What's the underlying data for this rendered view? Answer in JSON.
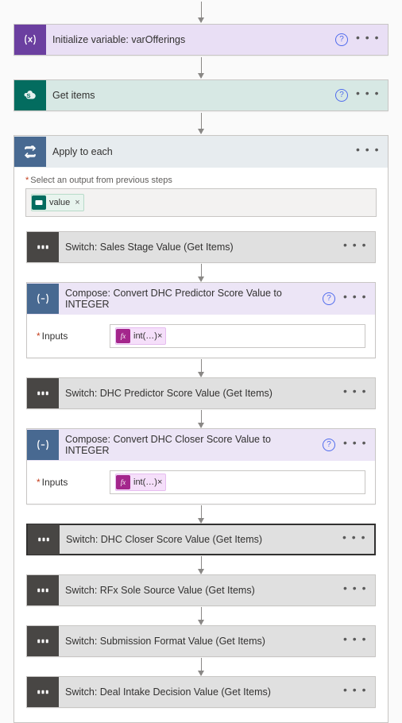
{
  "steps": {
    "init_var": {
      "title": "Initialize variable: varOfferings"
    },
    "get_items": {
      "title": "Get items"
    },
    "apply_each": {
      "title": "Apply to each",
      "select_label": "Select an output from previous steps",
      "token_label": "value",
      "token_close": "×"
    },
    "switches": {
      "sales_stage": "Switch: Sales Stage Value (Get Items)",
      "predictor": "Switch: DHC Predictor Score Value (Get Items)",
      "closer": "Switch: DHC Closer Score Value (Get Items)",
      "rfx": "Switch: RFx Sole Source Value (Get Items)",
      "submission": "Switch: Submission Format Value (Get Items)",
      "intake": "Switch: Deal Intake Decision Value (Get Items)"
    },
    "compose": {
      "predictor_title": "Compose: Convert DHC Predictor Score Value to INTEGER",
      "closer_title": "Compose: Convert DHC Closer Score Value to INTEGER",
      "inputs_label": "Inputs",
      "fx_text": "int(…)",
      "fx_close": "×"
    }
  },
  "icons": {
    "help": "?",
    "ellipsis": "• • •"
  }
}
